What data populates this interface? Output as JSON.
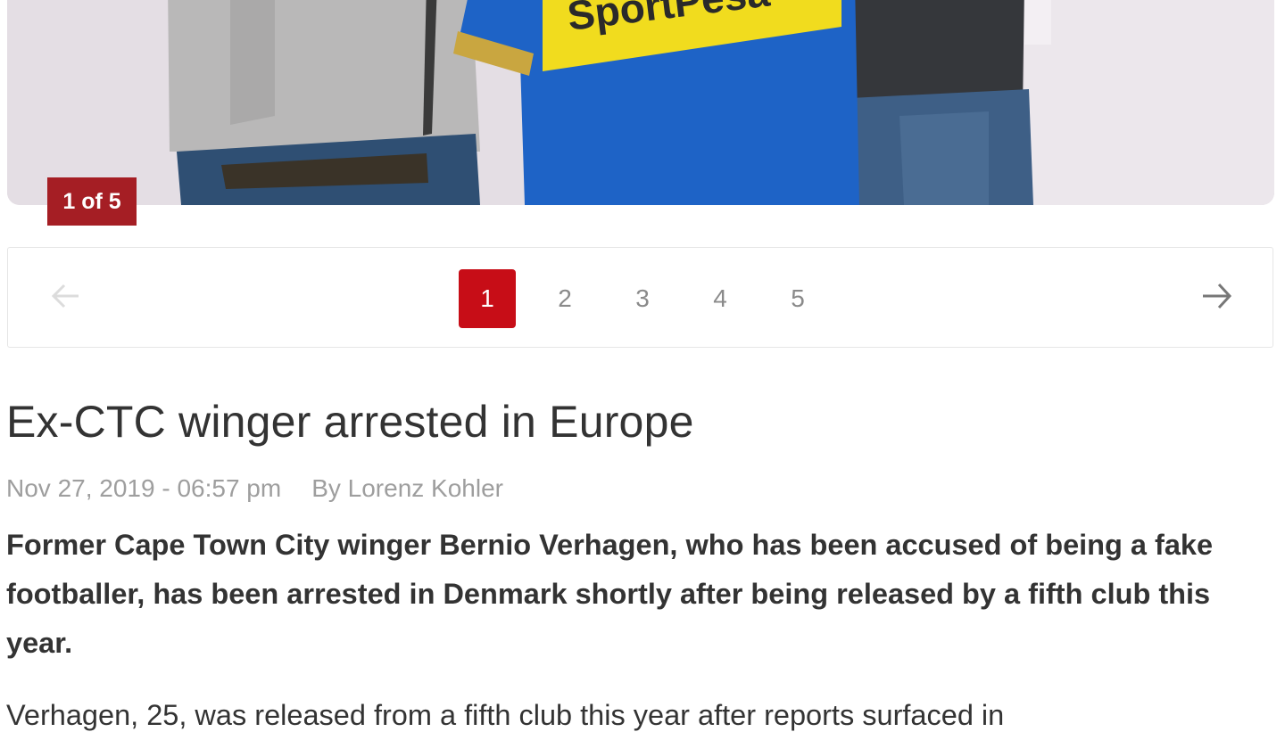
{
  "gallery": {
    "photo_sponsor": "SportPesa",
    "counter": "1 of 5",
    "pages": [
      "1",
      "2",
      "3",
      "4",
      "5"
    ],
    "active_page": "1"
  },
  "article": {
    "headline": "Ex-CTC winger arrested in Europe",
    "date": "Nov 27, 2019 - 06:57 pm",
    "author": "By Lorenz Kohler",
    "lead": "Former Cape Town City winger Bernio Verhagen, who has been accused of being a fake footballer, has been arrested in Denmark shortly after being released by a fifth club this year.",
    "body_start": "Verhagen, 25, was released from a fifth club this year after reports surfaced in"
  },
  "colors": {
    "accent": "#c70d17",
    "counter_bg": "#a51e24"
  }
}
